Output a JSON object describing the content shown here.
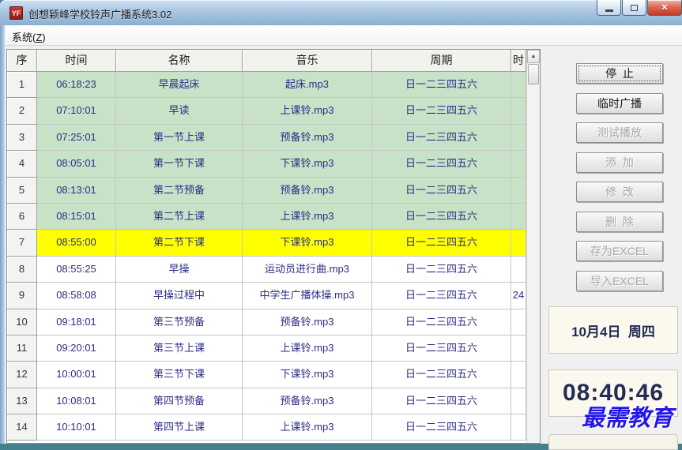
{
  "window": {
    "title": "创想颖峰学校铃声广播系统3.02",
    "icon": "YF"
  },
  "icons": {
    "minimize": "—",
    "maximize": "□",
    "close": "✕",
    "scroll_up": "▲"
  },
  "menu": {
    "system_prefix": "系统(",
    "system_key": "Z",
    "system_suffix": ")"
  },
  "table": {
    "headers": [
      "序",
      "时间",
      "名称",
      "音乐",
      "周期",
      "时"
    ],
    "rows": [
      {
        "no": "1",
        "time": "06:18:23",
        "name": "早晨起床",
        "music": "起床.mp3",
        "period": "日一二三四五六",
        "extra": "",
        "bg": "green"
      },
      {
        "no": "2",
        "time": "07:10:01",
        "name": "早读",
        "music": "上课铃.mp3",
        "period": "日一二三四五六",
        "extra": "",
        "bg": "green"
      },
      {
        "no": "3",
        "time": "07:25:01",
        "name": "第一节上课",
        "music": "预备铃.mp3",
        "period": "日一二三四五六",
        "extra": "",
        "bg": "green"
      },
      {
        "no": "4",
        "time": "08:05:01",
        "name": "第一节下课",
        "music": "下课铃.mp3",
        "period": "日一二三四五六",
        "extra": "",
        "bg": "green"
      },
      {
        "no": "5",
        "time": "08:13:01",
        "name": "第二节预备",
        "music": "预备铃.mp3",
        "period": "日一二三四五六",
        "extra": "",
        "bg": "green"
      },
      {
        "no": "6",
        "time": "08:15:01",
        "name": "第二节上课",
        "music": "上课铃.mp3",
        "period": "日一二三四五六",
        "extra": "",
        "bg": "green"
      },
      {
        "no": "7",
        "time": "08:55:00",
        "name": "第二节下课",
        "music": "下课铃.mp3",
        "period": "日一二三四五六",
        "extra": "",
        "bg": "yellow"
      },
      {
        "no": "8",
        "time": "08:55:25",
        "name": "早操",
        "music": "运动员进行曲.mp3",
        "period": "日一二三四五六",
        "extra": "",
        "bg": "white"
      },
      {
        "no": "9",
        "time": "08:58:08",
        "name": "早操过程中",
        "music": "中学生广播体操.mp3",
        "period": "日一二三四五六",
        "extra": "24",
        "bg": "white"
      },
      {
        "no": "10",
        "time": "09:18:01",
        "name": "第三节预备",
        "music": "预备铃.mp3",
        "period": "日一二三四五六",
        "extra": "",
        "bg": "white"
      },
      {
        "no": "11",
        "time": "09:20:01",
        "name": "第三节上课",
        "music": "上课铃.mp3",
        "period": "日一二三四五六",
        "extra": "",
        "bg": "white"
      },
      {
        "no": "12",
        "time": "10:00:01",
        "name": "第三节下课",
        "music": "下课铃.mp3",
        "period": "日一二三四五六",
        "extra": "",
        "bg": "white"
      },
      {
        "no": "13",
        "time": "10:08:01",
        "name": "第四节预备",
        "music": "预备铃.mp3",
        "period": "日一二三四五六",
        "extra": "",
        "bg": "white"
      },
      {
        "no": "14",
        "time": "10:10:01",
        "name": "第四节上课",
        "music": "上课铃.mp3",
        "period": "日一二三四五六",
        "extra": "",
        "bg": "white"
      }
    ]
  },
  "buttons": [
    {
      "label": "停  止",
      "enabled": true,
      "focused": true
    },
    {
      "label": "临时广播",
      "enabled": true,
      "focused": false
    },
    {
      "label": "测试播放",
      "enabled": false,
      "focused": false
    },
    {
      "label": "添  加",
      "enabled": false,
      "focused": false
    },
    {
      "label": "修  改",
      "enabled": false,
      "focused": false
    },
    {
      "label": "删  除",
      "enabled": false,
      "focused": false
    },
    {
      "label": "存为EXCEL",
      "enabled": false,
      "focused": false
    },
    {
      "label": "导入EXCEL",
      "enabled": false,
      "focused": false
    }
  ],
  "clock": {
    "date": "10月4日  周四",
    "time": "08:40:46"
  },
  "watermark": {
    "text": "最需教育",
    "color": "#2316ea"
  },
  "colors": {
    "row_green": "#c8e2c8",
    "row_yellow": "#ffff00",
    "row_white": "#ffffff",
    "cell_text": "#2d2d86",
    "clock_text": "#232c55",
    "titlebar_blue": "#a9c6e2",
    "highlight_yellow": "#ffff00"
  }
}
